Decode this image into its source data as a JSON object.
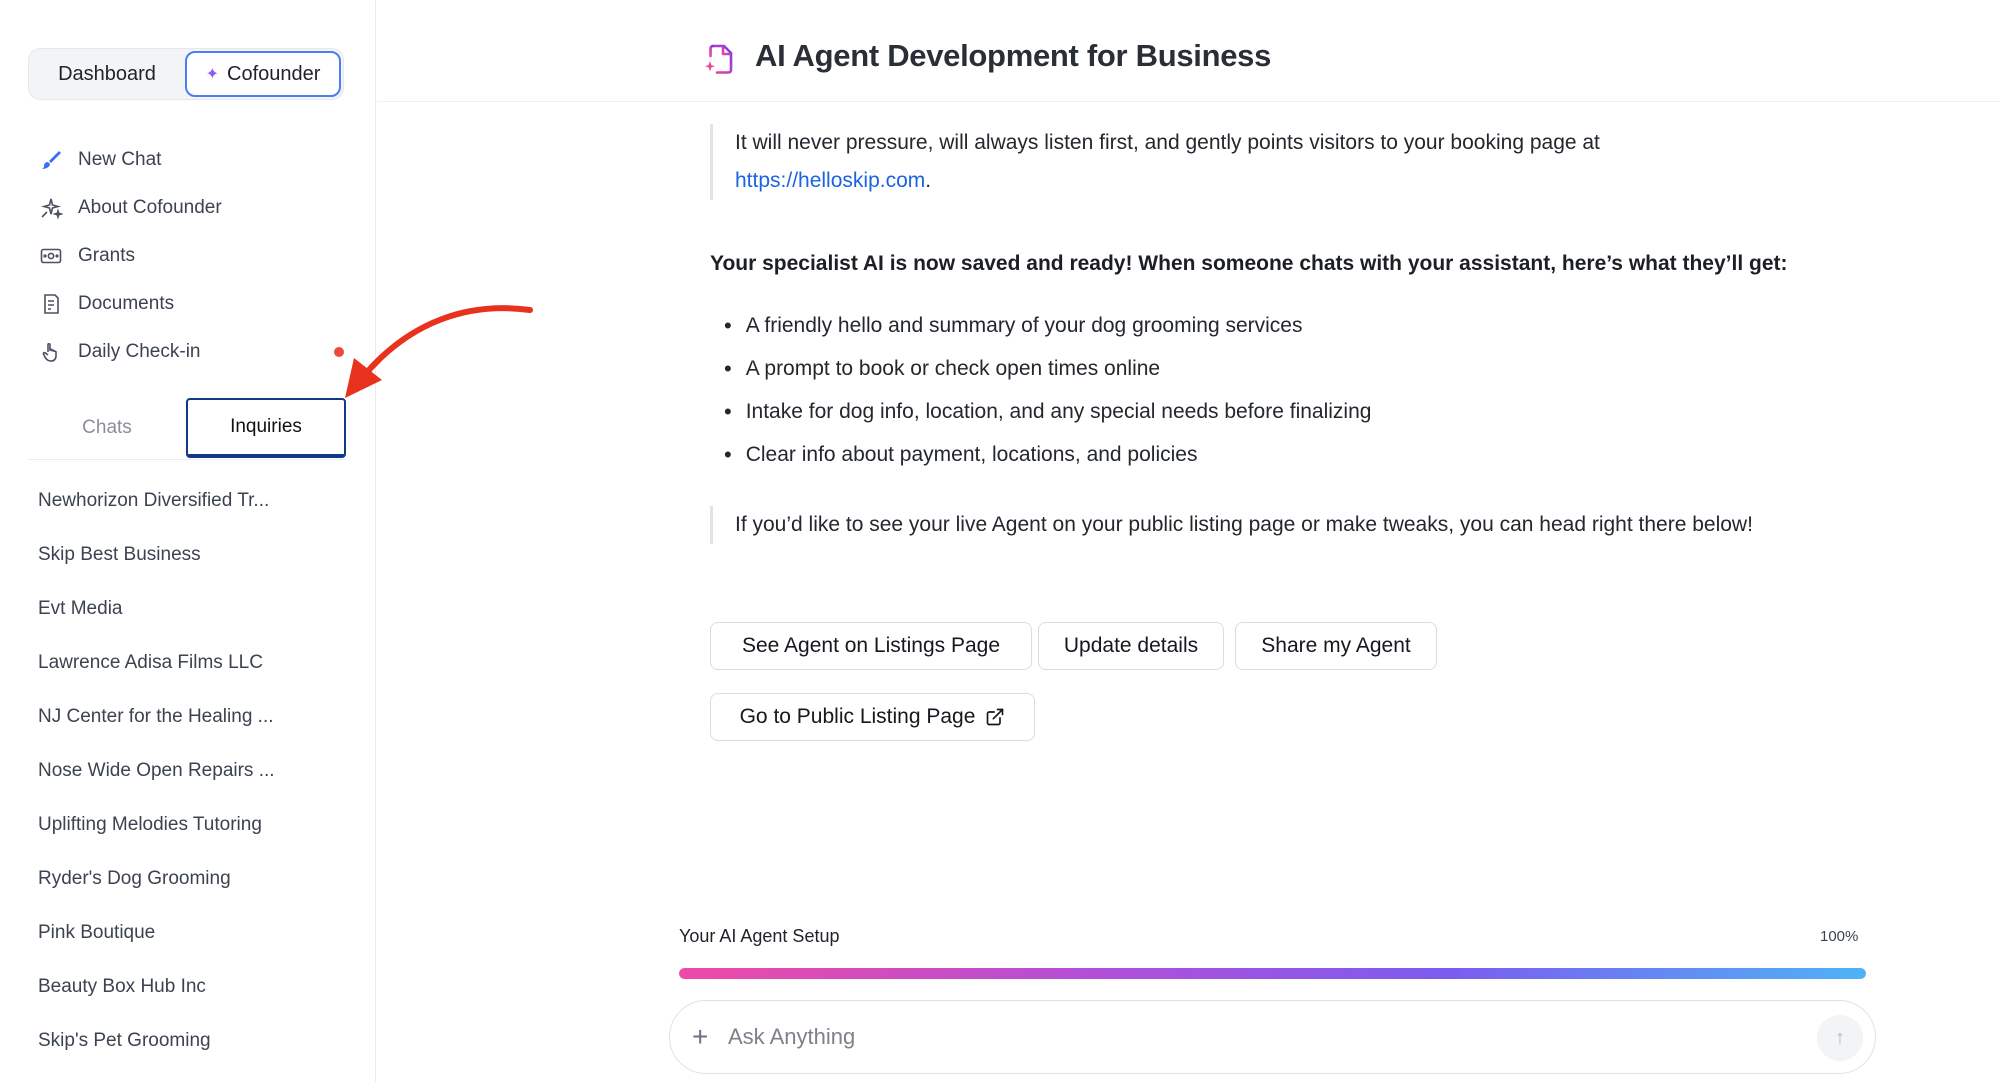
{
  "sidebar": {
    "segment": {
      "dashboard_label": "Dashboard",
      "cofounder_label": "Cofounder"
    },
    "nav": [
      {
        "label": "New Chat",
        "icon": "brush-icon"
      },
      {
        "label": "About Cofounder",
        "icon": "sparkles-icon"
      },
      {
        "label": "Grants",
        "icon": "money-icon"
      },
      {
        "label": "Documents",
        "icon": "document-icon"
      },
      {
        "label": "Daily Check-in",
        "icon": "hand-pointer-icon"
      }
    ],
    "tabs": {
      "chats_label": "Chats",
      "inquiries_label": "Inquiries",
      "active": "Inquiries"
    },
    "inquiries": [
      "Newhorizon Diversified Tr...",
      "Skip Best Business",
      "Evt Media",
      "Lawrence Adisa Films LLC",
      "NJ Center for the Healing ...",
      "Nose Wide Open Repairs ...",
      "Uplifting Melodies Tutoring",
      "Ryder's Dog Grooming",
      "Pink Boutique",
      "Beauty Box Hub Inc",
      "Skip's Pet Grooming"
    ]
  },
  "header": {
    "title": "AI Agent Development for Business",
    "icon": "document-sparkle-icon"
  },
  "message": {
    "quote1_text": "It will never pressure, will always listen first, and gently points visitors to your booking page at",
    "quote1_link": "https://helloskip.com",
    "quote1_suffix": ".",
    "bold_line": "Your specialist AI is now saved and ready! When someone chats with your assistant, here’s what they’ll get:",
    "bullets": [
      "A friendly hello and summary of your dog grooming services",
      "A prompt to book or check open times online",
      "Intake for dog info, location, and any special needs before finalizing",
      "Clear info about payment, locations, and policies"
    ],
    "quote2_text": "If you’d like to see your live Agent on your public listing page or make tweaks, you can head right there below!"
  },
  "actions": {
    "see_agent": "See Agent on Listings Page",
    "update_details": "Update details",
    "share_agent": "Share my Agent",
    "go_public": "Go to Public Listing Page"
  },
  "progress": {
    "label": "Your AI Agent Setup",
    "percent_text": "100%",
    "value": 1.0
  },
  "composer": {
    "placeholder": "Ask Anything"
  },
  "colors": {
    "accent": "#4d7cf3",
    "active_tab": "#0f3a86",
    "link": "#1a64e0",
    "notification": "#f0463c",
    "annotation_arrow": "#e8321e"
  }
}
